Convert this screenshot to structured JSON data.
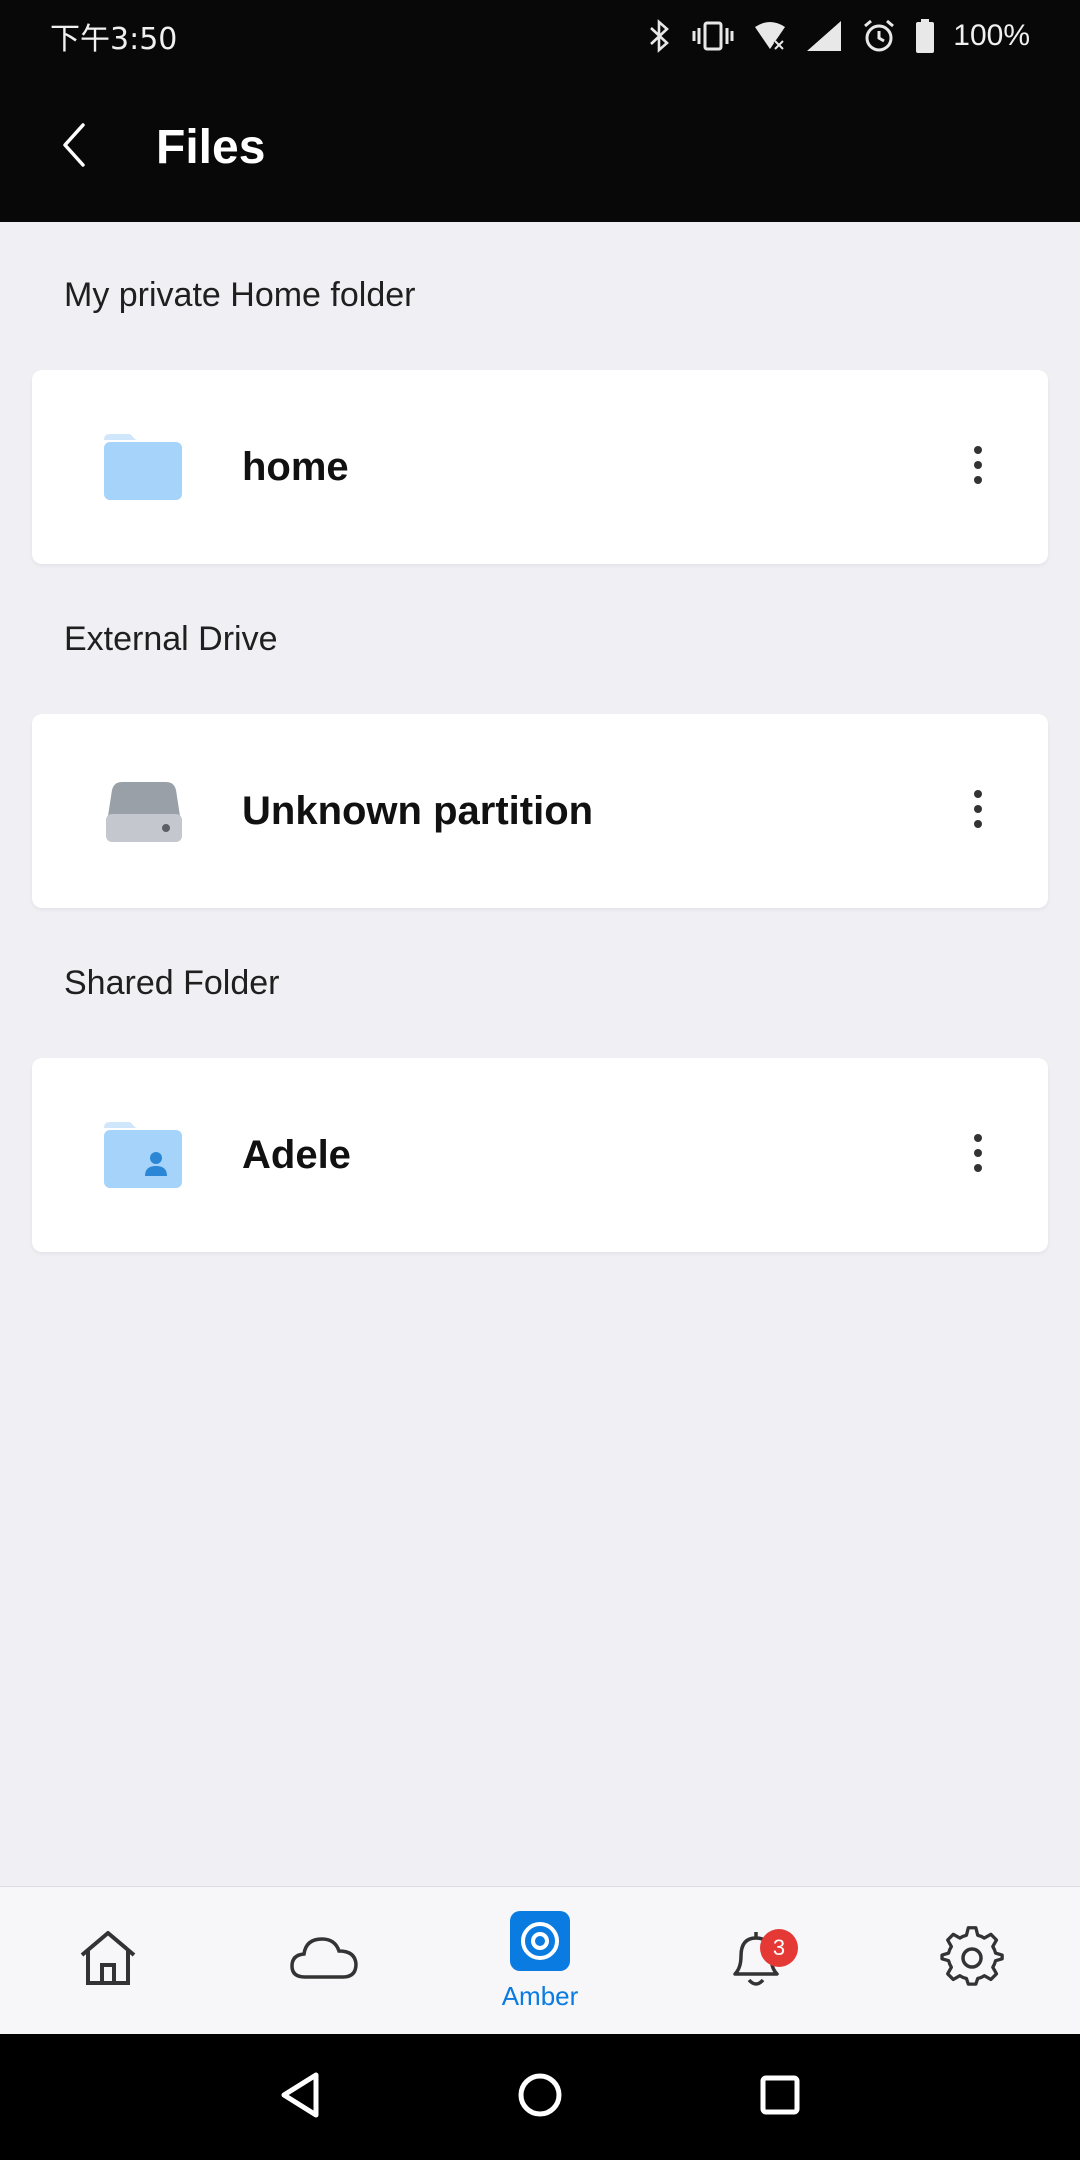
{
  "status_bar": {
    "time": "下午3:50",
    "battery": "100%"
  },
  "app_bar": {
    "title": "Files"
  },
  "sections": [
    {
      "label": "My private Home folder",
      "item": {
        "name": "home",
        "icon": "folder-icon"
      }
    },
    {
      "label": "External Drive",
      "item": {
        "name": "Unknown partition",
        "icon": "drive-icon"
      }
    },
    {
      "label": "Shared Folder",
      "item": {
        "name": "Adele",
        "icon": "shared-folder-icon"
      }
    }
  ],
  "bottom_nav": {
    "items": [
      {
        "name": "home-nav",
        "icon": "house-icon"
      },
      {
        "name": "cloud-nav",
        "icon": "cloud-icon"
      },
      {
        "name": "amber-nav",
        "icon": "amber-icon",
        "label": "Amber"
      },
      {
        "name": "notifications-nav",
        "icon": "bell-icon",
        "badge": "3"
      },
      {
        "name": "settings-nav",
        "icon": "gear-icon"
      }
    ]
  },
  "colors": {
    "accent": "#0a7be0",
    "folder": "#a6d3fa",
    "badge": "#e53935"
  }
}
